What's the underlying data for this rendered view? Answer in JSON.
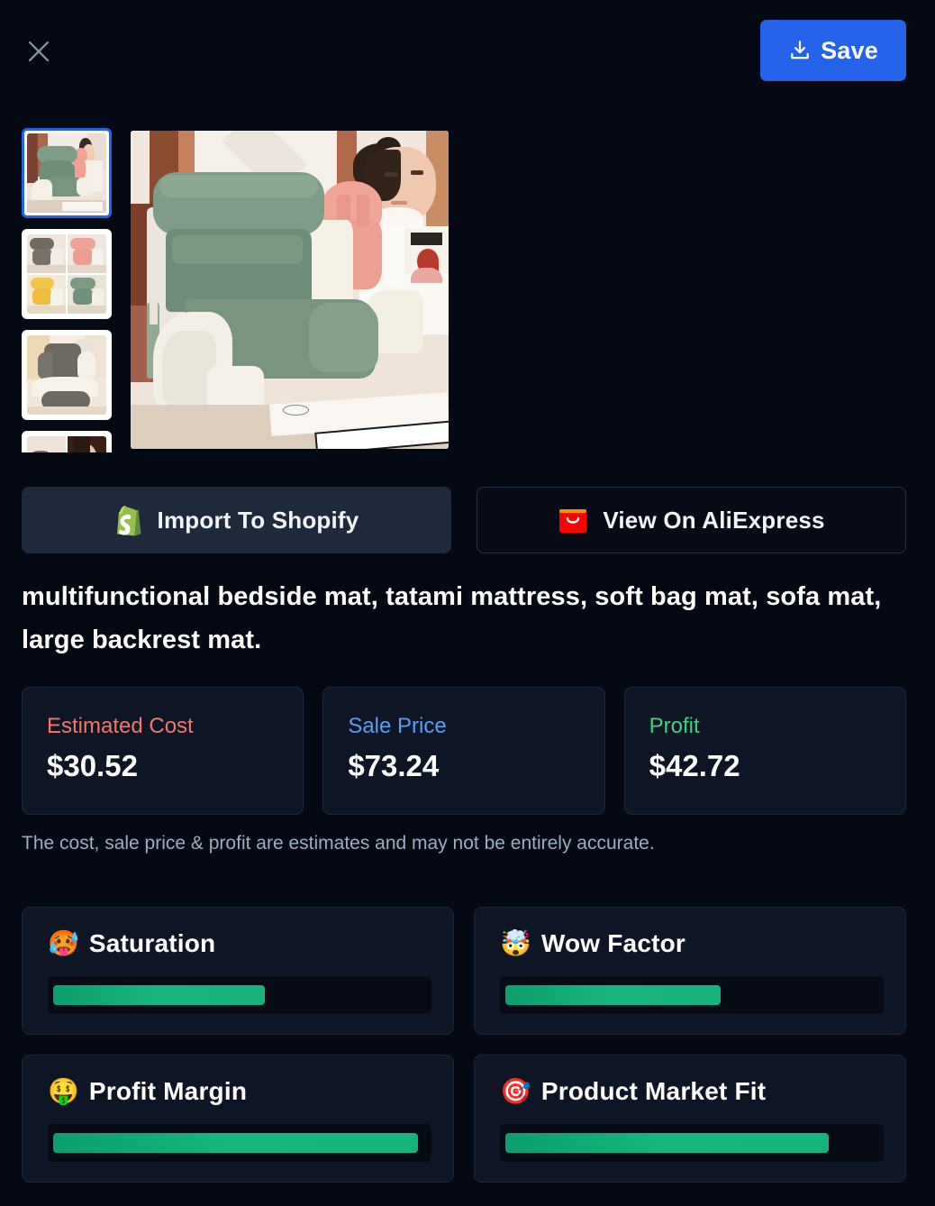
{
  "topbar": {
    "close_icon": "close-icon",
    "save_label": "Save",
    "save_icon": "download-icon",
    "save_color": "#2563eb"
  },
  "gallery": {
    "selected_index": 0,
    "selected_border_color": "#2563eb",
    "thumbnails": [
      {
        "name": "thumbnail-1",
        "alt": "green backrest pillow with woman reclining"
      },
      {
        "name": "thumbnail-2",
        "alt": "four color variants grid: grey, pink, yellow, green"
      },
      {
        "name": "thumbnail-3",
        "alt": "grey backrest pillow front view"
      },
      {
        "name": "thumbnail-4",
        "alt": "two lifestyle photos partially visible"
      }
    ],
    "main_image_alt": "woman reclining on green corduroy backrest reading pillow"
  },
  "actions": {
    "shopify": {
      "label": "Import To Shopify",
      "icon": "shopify-bag-icon"
    },
    "aliexpress": {
      "label": "View On AliExpress",
      "icon": "aliexpress-bag-icon",
      "icon_color": "#ff0000"
    }
  },
  "product": {
    "title": "multifunctional bedside mat, tatami mattress, soft bag mat, sofa mat, large backrest mat."
  },
  "pricing": {
    "cards": [
      {
        "label": "Estimated Cost",
        "value": "$30.52",
        "label_color": "#f4766a"
      },
      {
        "label": "Sale Price",
        "value": "$73.24",
        "label_color": "#5b9cf8"
      },
      {
        "label": "Profit",
        "value": "$42.72",
        "label_color": "#44d07f"
      }
    ],
    "disclaimer": "The cost, sale price & profit are estimates and may not be entirely accurate."
  },
  "metrics": {
    "bar_color": "#16b37c",
    "items": [
      {
        "emoji": "🥵",
        "emoji_name": "hot-face-emoji",
        "label": "Saturation",
        "percent": 58
      },
      {
        "emoji": "🤯",
        "emoji_name": "exploding-head-emoji",
        "label": "Wow Factor",
        "percent": 59
      },
      {
        "emoji": "🤑",
        "emoji_name": "money-mouth-face-emoji",
        "label": "Profit Margin",
        "percent": 98
      },
      {
        "emoji": "🎯",
        "emoji_name": "direct-hit-emoji",
        "label": "Product Market Fit",
        "percent": 87
      }
    ]
  }
}
